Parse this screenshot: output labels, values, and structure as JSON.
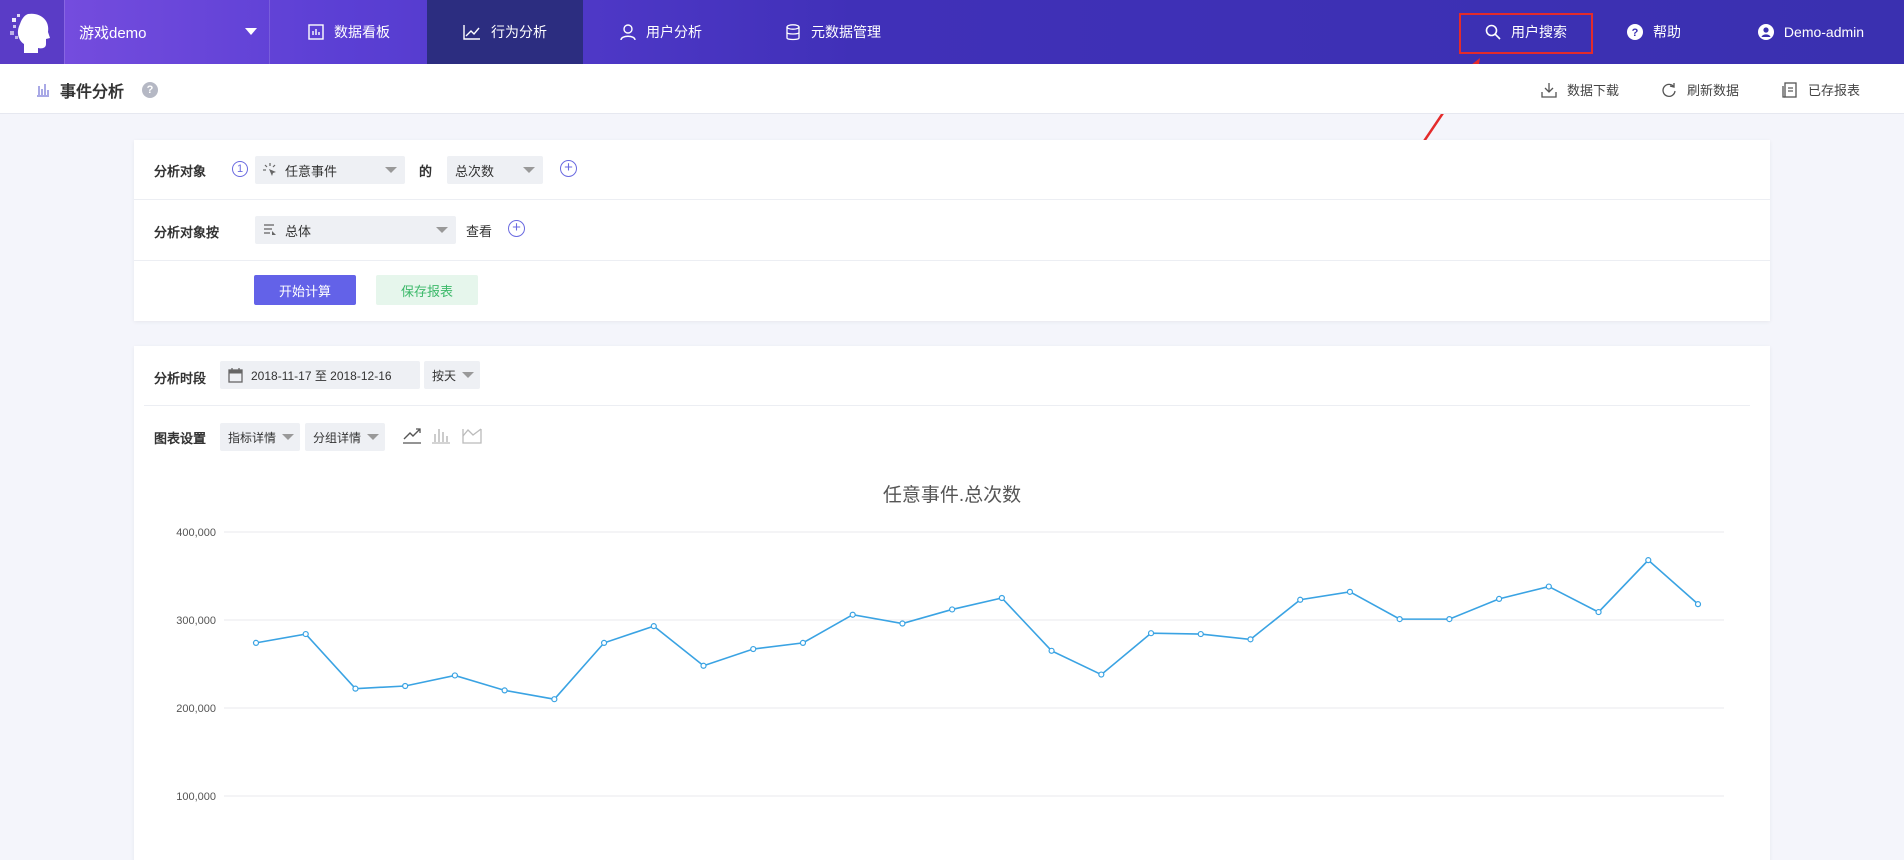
{
  "nav": {
    "project": "游戏demo",
    "items": [
      {
        "label": "数据看板",
        "icon": "dashboard-icon"
      },
      {
        "label": "行为分析",
        "icon": "trend-icon"
      },
      {
        "label": "用户分析",
        "icon": "user-icon"
      },
      {
        "label": "元数据管理",
        "icon": "database-icon"
      }
    ],
    "search": "用户搜索",
    "help": "帮助",
    "user": "Demo-admin"
  },
  "subheader": {
    "title": "事件分析",
    "help_mark": "?",
    "download": "数据下载",
    "refresh": "刷新数据",
    "saved": "已存报表"
  },
  "query": {
    "target_label": "分析对象",
    "target_index": "1",
    "event": "任意事件",
    "of": "的",
    "metric": "总次数",
    "group_label": "分析对象按",
    "group_by": "总体",
    "view": "查看",
    "run": "开始计算",
    "save": "保存报表"
  },
  "chart_panel": {
    "period_label": "分析时段",
    "date_range": "2018-11-17 至 2018-12-16",
    "granularity": "按天",
    "settings_label": "图表设置",
    "metric_detail": "指标详情",
    "group_detail": "分组详情"
  },
  "chart_data": {
    "type": "line",
    "title": "任意事件.总次数",
    "xlabel": "",
    "ylabel": "",
    "ylim": [
      0,
      400000
    ],
    "yticks": [
      "400,000",
      "300,000",
      "200,000",
      "100,000"
    ],
    "grid": true,
    "color": "#3aa3e3",
    "series": [
      {
        "values": [
          274000,
          284000,
          222000,
          225000,
          237000,
          220000,
          210000,
          274000,
          293000,
          248000,
          267000,
          274000,
          306000,
          296000,
          312000,
          325000,
          265000,
          238000,
          285000,
          284000,
          278000,
          323000,
          332000,
          301000,
          301000,
          324000,
          338000,
          309000,
          368000,
          318000
        ]
      }
    ]
  }
}
